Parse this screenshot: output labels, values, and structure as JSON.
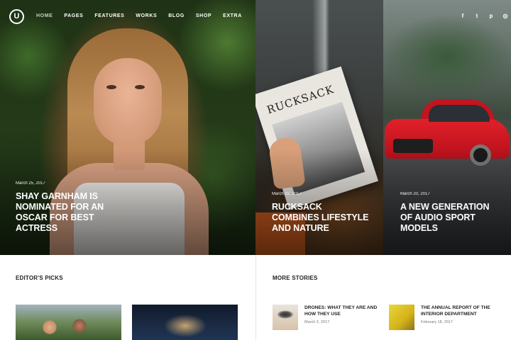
{
  "header": {
    "logo_letter": "U",
    "nav": [
      {
        "label": "HOME"
      },
      {
        "label": "PAGES"
      },
      {
        "label": "FEATURES"
      },
      {
        "label": "WORKS"
      },
      {
        "label": "BLOG"
      },
      {
        "label": "SHOP"
      },
      {
        "label": "EXTRA"
      }
    ],
    "social": [
      {
        "icon": "facebook-icon",
        "glyph": "f"
      },
      {
        "icon": "twitter-icon",
        "glyph": "t"
      },
      {
        "icon": "pinterest-icon",
        "glyph": "p"
      },
      {
        "icon": "dribbble-icon",
        "glyph": "◎"
      }
    ]
  },
  "hero": {
    "features": [
      {
        "date": "March 25, 2017",
        "title": "SHAY GARNHAM IS NOMINATED FOR AN OSCAR FOR BEST ACTRESS"
      },
      {
        "date": "March 22, 2017",
        "title": "RUCKSACK COMBINES LIFESTYLE AND NATURE"
      },
      {
        "date": "March 20, 2017",
        "title": "A NEW GENERATION OF AUDIO SPORT MODELS"
      }
    ],
    "magazine_title": "RUCKSACK"
  },
  "editors_picks": {
    "title": "EDITOR'S PICKS"
  },
  "more_stories": {
    "title": "MORE STORIES",
    "items": [
      {
        "title": "DRONES: WHAT THEY ARE AND HOW THEY USE",
        "date": "March 2, 2017"
      },
      {
        "title": "THE ANNUAL REPORT OF THE INTERIOR DEPARTMENT",
        "date": "February 18, 2017"
      }
    ]
  },
  "colors": {
    "text_dark": "#222222",
    "text_muted": "#777777",
    "hero_text": "#ffffff",
    "car_red": "#e2202a"
  }
}
